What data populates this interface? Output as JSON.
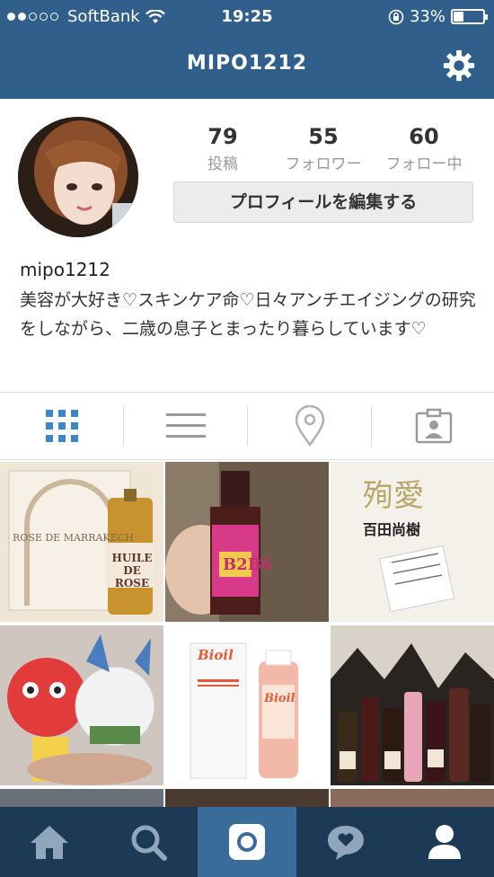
{
  "status": {
    "carrier": "SoftBank",
    "time": "19:25",
    "battery": "33%",
    "battery_level": 0.33
  },
  "nav": {
    "title": "MIPO1212",
    "settings_icon": "gear-icon"
  },
  "profile": {
    "stats": [
      {
        "value": "79",
        "label": "投稿"
      },
      {
        "value": "55",
        "label": "フォロワー"
      },
      {
        "value": "60",
        "label": "フォロー中"
      }
    ],
    "edit_button": "プロフィールを編集する",
    "username": "mipo1212",
    "bio": "美容が大好き♡スキンケア命♡日々アンチエイジングの研究をしながら、二歳の息子とまったり暮らしています♡"
  },
  "tabs": [
    "grid-icon",
    "list-icon",
    "location-pin-icon",
    "tagged-person-icon"
  ],
  "photos": [
    {
      "texts": [
        "ROSE DE MARRAKECH",
        "HUILE DE ROSE"
      ]
    },
    {
      "texts": [
        "B2B6"
      ]
    },
    {
      "texts": [
        "殉愛",
        "百田尚樹"
      ]
    },
    {
      "texts": []
    },
    {
      "texts": [
        "Bioil",
        "Bioil"
      ]
    },
    {
      "texts": []
    }
  ],
  "bottom_nav": [
    "home-icon",
    "search-icon",
    "camera-icon",
    "activity-icon",
    "profile-icon"
  ],
  "colors": {
    "nav_bar": "#2f5f8a",
    "bottom_bar": "#1c3a56",
    "active_tab": "#3a6c99",
    "grid_accent": "#3f86c6"
  }
}
